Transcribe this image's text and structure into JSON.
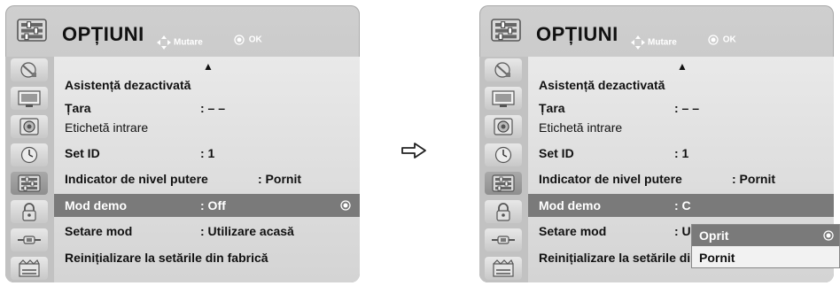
{
  "panels": [
    {
      "title": "OPȚIUNI",
      "hint_move": "Mutare",
      "hint_ok": "OK",
      "scroll_up": "▲",
      "rows": [
        {
          "label": "Asistență dezactivată",
          "value": ""
        },
        {
          "label": "Țara",
          "value": ": – –"
        },
        {
          "label": "Etichetă intrare",
          "value": ""
        },
        {
          "label": "Set ID",
          "value": ": 1"
        },
        {
          "label": "Indicator de nivel putere",
          "value": ": Pornit"
        },
        {
          "label": "Mod demo",
          "value": ": Off"
        },
        {
          "label": "Setare mod",
          "value": ": Utilizare acasă"
        },
        {
          "label": "Reinițializare la setările din fabrică",
          "value": ""
        }
      ]
    },
    {
      "title": "OPȚIUNI",
      "hint_move": "Mutare",
      "hint_ok": "OK",
      "scroll_up": "▲",
      "rows": [
        {
          "label": "Asistență dezactivată",
          "value": ""
        },
        {
          "label": "Țara",
          "value": ": – –"
        },
        {
          "label": "Etichetă intrare",
          "value": ""
        },
        {
          "label": "Set ID",
          "value": ": 1"
        },
        {
          "label": "Indicator de nivel putere",
          "value": ": Pornit"
        },
        {
          "label": "Mod demo",
          "value": ": C"
        },
        {
          "label": "Setare mod",
          "value": ": U"
        },
        {
          "label": "Reinițializare la setările din fabrică",
          "value": ""
        }
      ],
      "popup_options": [
        "Oprit",
        "Pornit"
      ]
    }
  ],
  "sidebar_icons": [
    "satellite-icon",
    "picture-icon",
    "audio-icon",
    "clock-icon",
    "options-icon",
    "lock-icon",
    "input-icon",
    "media-icon"
  ],
  "colors": {
    "highlight": "#7a7a7a",
    "panel": "#c4c4c4",
    "content": "#e2e2e2"
  }
}
